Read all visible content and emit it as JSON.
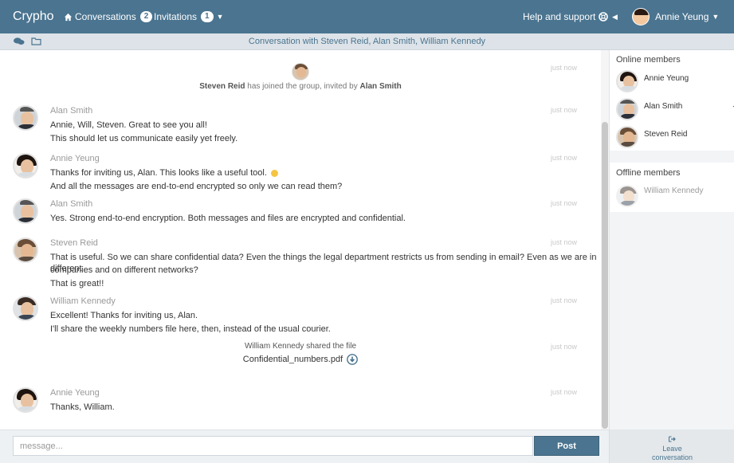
{
  "app": {
    "brand": "Crypho"
  },
  "nav": {
    "conversations_label": "Conversations",
    "conversations_count": "2",
    "invitations_label": "Invitations",
    "invitations_count": "1",
    "help_label": "Help and support",
    "user_name": "Annie Yeung"
  },
  "subheader": {
    "title": "Conversation with Steven Reid, Alan Smith, William Kennedy"
  },
  "icons": {
    "home": "home-icon",
    "chat": "chat-bubbles-icon",
    "folder": "folder-icon",
    "help": "lifebuoy-icon",
    "download": "download-circle-icon",
    "star": "star-icon",
    "leave": "sign-out-icon"
  },
  "colors": {
    "navbar": "#4a7490",
    "subheader": "#dde3e8",
    "accent": "#4a7490"
  },
  "chat": {
    "join_notice": {
      "name": "Steven Reid",
      "middle": "has joined the group, invited by",
      "inviter": "Alan Smith",
      "time": "just now"
    },
    "messages": [
      {
        "sender": "Alan Smith",
        "time": "just now",
        "lines": [
          "Annie, Will, Steven. Great to see you all!",
          "This should let us communicate easily yet freely."
        ]
      },
      {
        "sender": "Annie Yeung",
        "time": "just now",
        "lines": [
          "Thanks for inviting us, Alan. This looks like a useful tool.",
          "And all the messages are end-to-end encrypted so only we can read them?"
        ]
      },
      {
        "sender": "Alan Smith",
        "time": "just now",
        "lines": [
          "Yes. Strong end-to-end encryption. Both messages and files are encrypted and confidential."
        ]
      },
      {
        "sender": "Steven Reid",
        "time": "just now",
        "lines": [
          "That is useful. So we can share confidential data? Even the things the legal department restricts us from sending in email? Even as we are in different",
          "companies and on different networks?",
          "That is great!!"
        ]
      },
      {
        "sender": "William Kennedy",
        "time": "just now",
        "lines": [
          "Excellent! Thanks for inviting us, Alan.",
          "I'll share the weekly numbers file here, then, instead of the usual courier."
        ]
      },
      {
        "sender": "Annie Yeung",
        "time": "just now",
        "lines": [
          "Thanks, William."
        ]
      }
    ],
    "file_share": {
      "text": "William Kennedy shared the file",
      "file_name": "Confidential_numbers.pdf",
      "time": "just now"
    }
  },
  "composer": {
    "placeholder": "message...",
    "post_label": "Post"
  },
  "members": {
    "online_title": "Online members",
    "online": [
      "Annie Yeung",
      "Alan Smith",
      "Steven Reid"
    ],
    "offline_title": "Offline members",
    "offline": [
      "William Kennedy"
    ]
  },
  "leave": {
    "line1": "Leave",
    "line2": "conversation"
  }
}
